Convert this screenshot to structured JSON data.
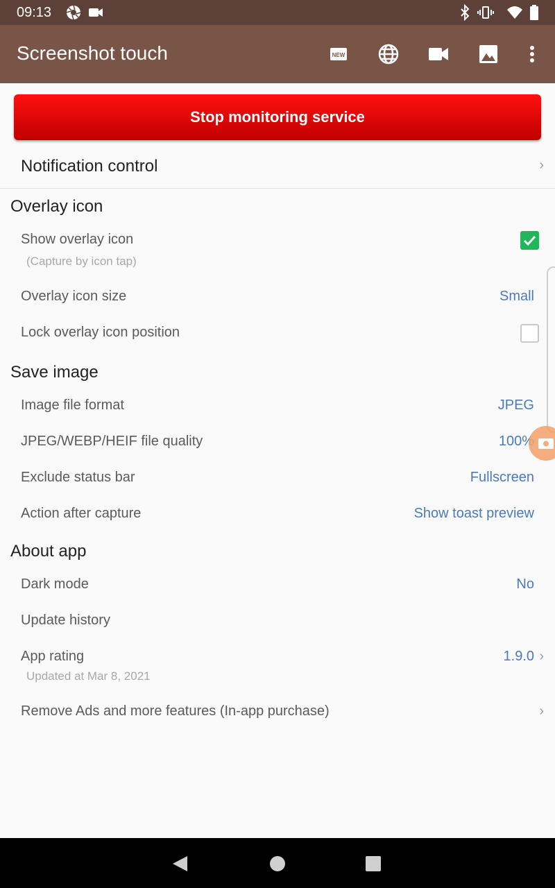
{
  "status_bar": {
    "time": "09:13",
    "left_icons": [
      "camera-shutter-icon",
      "video-record-icon"
    ],
    "right_icons": [
      "bluetooth-icon",
      "vibrate-icon",
      "wifi-icon",
      "battery-icon"
    ]
  },
  "app_bar": {
    "title": "Screenshot touch",
    "icons": [
      "new-badge-icon",
      "globe-icon",
      "video-camera-icon",
      "image-icon",
      "more-vert-icon"
    ],
    "new_badge_text": "NEW",
    "color": "#795548"
  },
  "stop_button": {
    "label": "Stop monitoring service",
    "color": "#e00000"
  },
  "notification_control": {
    "label": "Notification control"
  },
  "sections": {
    "overlay": {
      "header": "Overlay icon",
      "show_overlay": {
        "label": "Show overlay icon",
        "sub": "(Capture by icon tap)",
        "checked": true
      },
      "overlay_size": {
        "label": "Overlay icon size",
        "value": "Small"
      },
      "lock_position": {
        "label": "Lock overlay icon position",
        "checked": false
      }
    },
    "save_image": {
      "header": "Save image",
      "file_format": {
        "label": "Image file format",
        "value": "JPEG"
      },
      "file_quality": {
        "label": "JPEG/WEBP/HEIF file quality",
        "value": "100%"
      },
      "exclude_status": {
        "label": "Exclude status bar",
        "value": "Fullscreen"
      },
      "action_after": {
        "label": "Action after capture",
        "value": "Show toast preview"
      }
    },
    "about": {
      "header": "About app",
      "dark_mode": {
        "label": "Dark mode",
        "value": "No"
      },
      "update_history": {
        "label": "Update history"
      },
      "app_rating": {
        "label": "App rating",
        "value": "1.9.0",
        "sub": "Updated at Mar 8, 2021"
      },
      "remove_ads": {
        "label": "Remove Ads and more features (In-app purchase)"
      }
    }
  },
  "colors": {
    "accent_value": "#4a7ab8",
    "checkbox_checked": "#1eb85a"
  },
  "nav_bar": {
    "buttons": [
      "back-icon",
      "home-icon",
      "recents-icon"
    ]
  }
}
